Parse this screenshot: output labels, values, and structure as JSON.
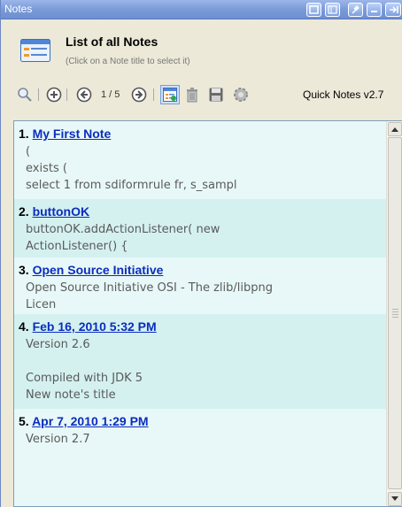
{
  "window": {
    "title": "Notes"
  },
  "header": {
    "title": "List of all Notes",
    "subtitle": "(Click on a Note title to select it)"
  },
  "toolbar": {
    "pager": "1 / 5",
    "version": "Quick Notes v2.7",
    "icons": [
      "search-icon",
      "add-icon",
      "previous-icon",
      "next-icon",
      "list-view-icon",
      "trash-icon",
      "save-icon",
      "settings-icon"
    ]
  },
  "notes": [
    {
      "num": "1.",
      "title": "My First Note",
      "body": "(\nexists (\nselect 1 from sdiformrule fr, s_sampl"
    },
    {
      "num": "2.",
      "title": "buttonOK",
      "body": "buttonOK.addActionListener( new\nActionListener() {"
    },
    {
      "num": "3.",
      "title": "Open Source Initiative",
      "body": "Open Source Initiative OSI - The zlib/libpng\nLicen"
    },
    {
      "num": "4.",
      "title": "Feb 16, 2010 5:32 PM",
      "body": "Version 2.6\n\nCompiled with JDK 5\nNew note's title"
    },
    {
      "num": "5.",
      "title": "Apr 7, 2010 1:29 PM",
      "body": "Version 2.7"
    }
  ],
  "colors": {
    "titlebar": "#7a9ad8",
    "link": "#0a2dbe",
    "note_light": "#e8f8f8",
    "note_dark": "#d4f1f0"
  }
}
